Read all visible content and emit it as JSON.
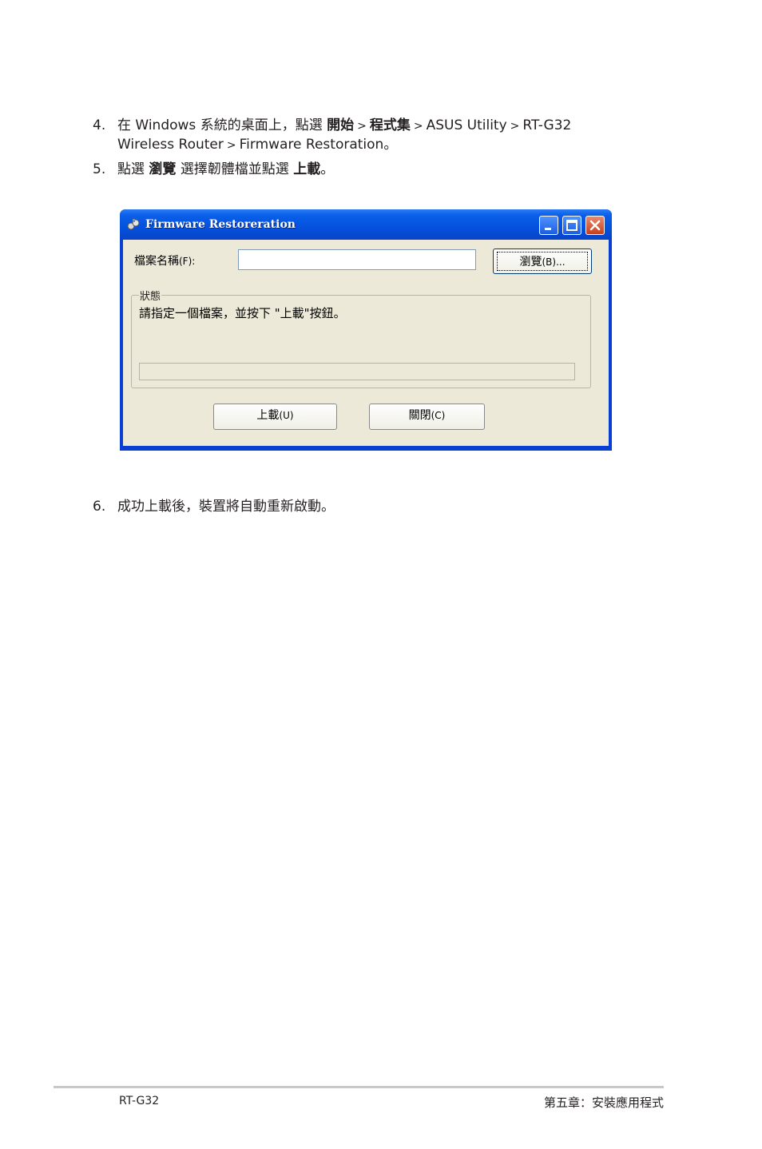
{
  "steps": [
    {
      "number": "4.",
      "line1_prefix": "在 Windows   系統的桌面上，點選",
      "start": "開始",
      "sep1": ">",
      "programs": "程式集",
      "sep2": ">",
      "asus_utility": "ASUS Utility",
      "sep3": ">",
      "rtg32": "RT-G32",
      "line2_a": "Wireless Router",
      "sep4": ">",
      "line2_b": "Firmware Restoration",
      "line2_end": "。"
    },
    {
      "number": "5.",
      "prefix": "點選",
      "browse": "瀏覽",
      "middle": "選擇韌體檔並點選",
      "upload": "上載",
      "end": "。"
    },
    {
      "number": "6.",
      "text": "成功上載後，裝置將自動重新啟動。"
    }
  ],
  "window": {
    "title": "Firmware Restoreration",
    "filename_label": "檔案名稱",
    "filename_hotkey": "(F):",
    "filename_value": "",
    "browse_button": "瀏覽",
    "browse_hotkey": "(B)...",
    "group_title": "狀態",
    "status_message": "請指定一個檔案，並按下 \"上載\"按鈕。",
    "upload_button": "上載",
    "upload_hotkey": "(U)",
    "close_button": "關閉",
    "close_hotkey": "(C)",
    "progress": 0
  },
  "footer": {
    "left": "RT-G32",
    "right": "第五章：安裝應用程式"
  }
}
